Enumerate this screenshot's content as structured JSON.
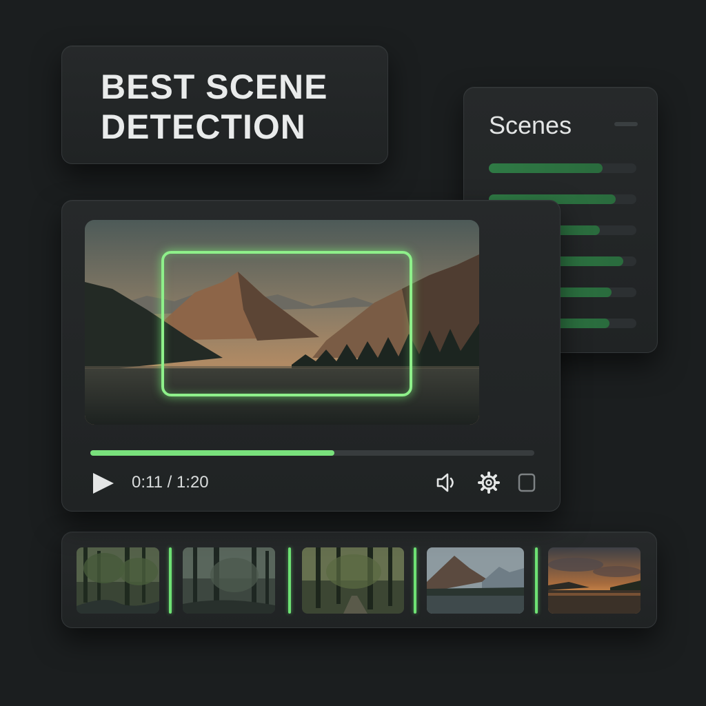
{
  "title_card": {
    "text": "BEST SCENE\nDETECTION"
  },
  "scenes_panel": {
    "title": "Scenes",
    "items": [
      {
        "level": 0.77
      },
      {
        "level": 0.86
      },
      {
        "level": 0.75
      },
      {
        "level": 0.91
      },
      {
        "level": 0.83
      },
      {
        "level": 0.82
      }
    ]
  },
  "player": {
    "time": "0:11 / 1:20",
    "progress": 0.55,
    "icons": {
      "play": "play-icon",
      "volume": "volume-icon",
      "settings": "gear-icon",
      "fullscreen": "fullscreen-icon"
    }
  },
  "filmstrip": {
    "thumbnails": [
      {
        "scene": "forest-stream"
      },
      {
        "scene": "misty-forest"
      },
      {
        "scene": "forest-path"
      },
      {
        "scene": "mountain-lake"
      },
      {
        "scene": "sunset-lake"
      }
    ]
  },
  "colors": {
    "accent": "#79e07c",
    "background": "#1b1e1f",
    "panel": "#24272a"
  }
}
